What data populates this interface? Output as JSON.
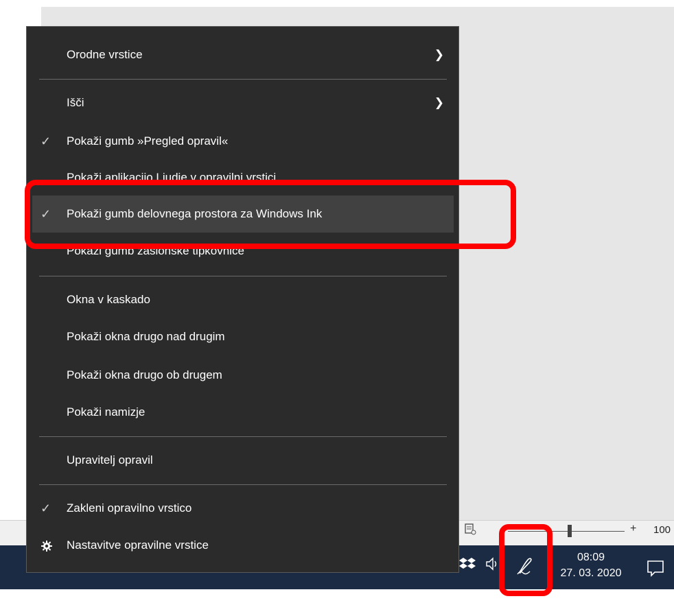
{
  "menu": {
    "items": [
      {
        "label": "Orodne vrstice",
        "checked": false,
        "submenu": true
      },
      {
        "label": "Išči",
        "checked": false,
        "submenu": true
      },
      {
        "label": "Pokaži gumb »Pregled opravil«",
        "checked": true,
        "submenu": false
      },
      {
        "label": "Pokaži aplikacijo Ljudje v opravilni vrstici",
        "checked": false,
        "submenu": false
      },
      {
        "label": "Pokaži gumb delovnega prostora za Windows Ink",
        "checked": true,
        "submenu": false,
        "highlighted": true
      },
      {
        "label": "Pokaži gumb zaslonske tipkovnice",
        "checked": false,
        "submenu": false
      },
      {
        "label": "Okna v kaskado",
        "checked": false,
        "submenu": false
      },
      {
        "label": "Pokaži okna drugo nad drugim",
        "checked": false,
        "submenu": false
      },
      {
        "label": "Pokaži okna drugo ob drugem",
        "checked": false,
        "submenu": false
      },
      {
        "label": "Pokaži namizje",
        "checked": false,
        "submenu": false
      },
      {
        "label": "Upravitelj opravil",
        "checked": false,
        "submenu": false
      },
      {
        "label": "Zakleni opravilno vrstico",
        "checked": true,
        "submenu": false
      },
      {
        "label": "Nastavitve opravilne vrstice",
        "checked": false,
        "submenu": false,
        "icon": "gear-icon"
      }
    ],
    "check_glyph": "✓",
    "arrow_glyph": "❯"
  },
  "statusbar": {
    "zoom_plus": "+",
    "zoom_label": "100"
  },
  "taskbar": {
    "clock_time": "08:09",
    "clock_date": "27. 03. 2020",
    "tray_chevron": "ııı"
  },
  "annotation_color": "#ff0000"
}
